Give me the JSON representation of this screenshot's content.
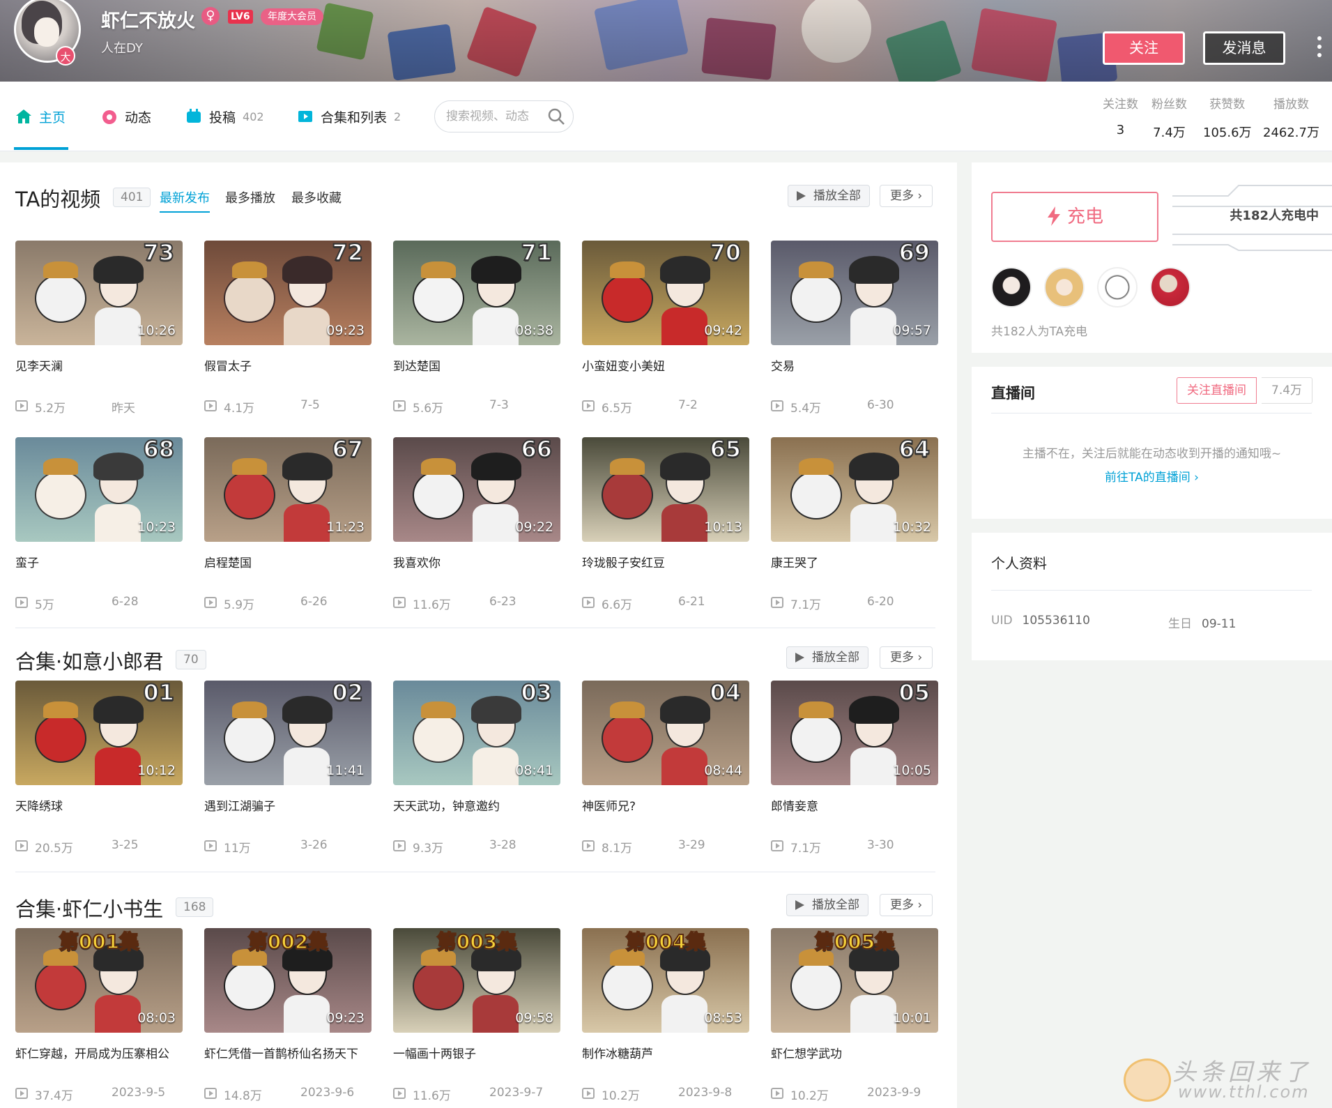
{
  "header": {
    "username": "虾仁不放火",
    "gender_symbol": "♀",
    "level": "LV6",
    "vip_label": "年度大会员",
    "signature": "人在DY",
    "avatar_badge": "大",
    "follow_label": "关注",
    "message_label": "发消息"
  },
  "nav": {
    "home": "主页",
    "dynamic": "动态",
    "uploads": "投稿",
    "uploads_count": "402",
    "collections": "合集和列表",
    "collections_count": "2",
    "search_placeholder": "搜索视频、动态"
  },
  "stats": [
    {
      "label": "关注数",
      "value": "3"
    },
    {
      "label": "粉丝数",
      "value": "7.4万"
    },
    {
      "label": "获赞数",
      "value": "105.6万"
    },
    {
      "label": "播放数",
      "value": "2462.7万"
    }
  ],
  "videos_section": {
    "title": "TA的视频",
    "count": "401",
    "sort_tabs": [
      "最新发布",
      "最多播放",
      "最多收藏"
    ],
    "play_all": "播放全部",
    "more": "更多",
    "items": [
      {
        "ep": "73",
        "duration": "10:26",
        "title": "见李天澜",
        "plays": "5.2万",
        "date": "昨天"
      },
      {
        "ep": "72",
        "duration": "09:23",
        "title": "假冒太子",
        "plays": "4.1万",
        "date": "7-5"
      },
      {
        "ep": "71",
        "duration": "08:38",
        "title": "到达楚国",
        "plays": "5.6万",
        "date": "7-3"
      },
      {
        "ep": "70",
        "duration": "09:42",
        "title": "小蛮妞变小美妞",
        "plays": "6.5万",
        "date": "7-2"
      },
      {
        "ep": "69",
        "duration": "09:57",
        "title": "交易",
        "plays": "5.4万",
        "date": "6-30"
      },
      {
        "ep": "68",
        "duration": "10:23",
        "title": "蛮子",
        "plays": "5万",
        "date": "6-28"
      },
      {
        "ep": "67",
        "duration": "11:23",
        "title": "启程楚国",
        "plays": "5.9万",
        "date": "6-26"
      },
      {
        "ep": "66",
        "duration": "09:22",
        "title": "我喜欢你",
        "plays": "11.6万",
        "date": "6-23"
      },
      {
        "ep": "65",
        "duration": "10:13",
        "title": "玲珑骰子安红豆",
        "plays": "6.6万",
        "date": "6-21"
      },
      {
        "ep": "64",
        "duration": "10:32",
        "title": "康王哭了",
        "plays": "7.1万",
        "date": "6-20"
      }
    ]
  },
  "collection1": {
    "title": "合集·如意小郎君",
    "count": "70",
    "play_all": "播放全部",
    "more": "更多",
    "items": [
      {
        "ep": "01",
        "duration": "10:12",
        "title": "天降绣球",
        "plays": "20.5万",
        "date": "3-25"
      },
      {
        "ep": "02",
        "duration": "11:41",
        "title": "遇到江湖骗子",
        "plays": "11万",
        "date": "3-26"
      },
      {
        "ep": "03",
        "duration": "08:41",
        "title": "天天武功，钟意邀约",
        "plays": "9.3万",
        "date": "3-28"
      },
      {
        "ep": "04",
        "duration": "08:44",
        "title": "神医师兄?",
        "plays": "8.1万",
        "date": "3-29"
      },
      {
        "ep": "05",
        "duration": "10:05",
        "title": "郎情妾意",
        "plays": "7.1万",
        "date": "3-30"
      }
    ]
  },
  "collection2": {
    "title": "合集·虾仁小书生",
    "count": "168",
    "play_all": "播放全部",
    "more": "更多",
    "items": [
      {
        "ep": "第001集",
        "duration": "08:03",
        "title": "虾仁穿越，开局成为压寨相公",
        "plays": "37.4万",
        "date": "2023-9-5"
      },
      {
        "ep": "第002集",
        "duration": "09:23",
        "title": "虾仁凭借一首鹊桥仙名扬天下",
        "plays": "14.8万",
        "date": "2023-9-6"
      },
      {
        "ep": "第003集",
        "duration": "09:58",
        "title": "一幅画十两银子",
        "plays": "11.6万",
        "date": "2023-9-7"
      },
      {
        "ep": "第004集",
        "duration": "08:53",
        "title": "制作冰糖葫芦",
        "plays": "10.2万",
        "date": "2023-9-8"
      },
      {
        "ep": "第005集",
        "duration": "10:01",
        "title": "虾仁想学武功",
        "plays": "10.2万",
        "date": "2023-9-9"
      }
    ]
  },
  "charge": {
    "button": "充电",
    "count_label": "共182人充电中",
    "note": "共182人为TA充电"
  },
  "live": {
    "title": "直播间",
    "follow_label": "关注直播间",
    "fans": "7.4万",
    "message": "主播不在，关注后就能在动态收到开播的通知哦~",
    "link": "前往TA的直播间"
  },
  "profile": {
    "title": "个人资料",
    "uid_label": "UID",
    "uid": "105536110",
    "birthday_label": "生日",
    "birthday": "09-11"
  },
  "watermark": {
    "text": "头条回来了",
    "url": "www.tthl.com"
  },
  "colors": {
    "accent": "#00a1d6",
    "pink": "#f0596f"
  }
}
